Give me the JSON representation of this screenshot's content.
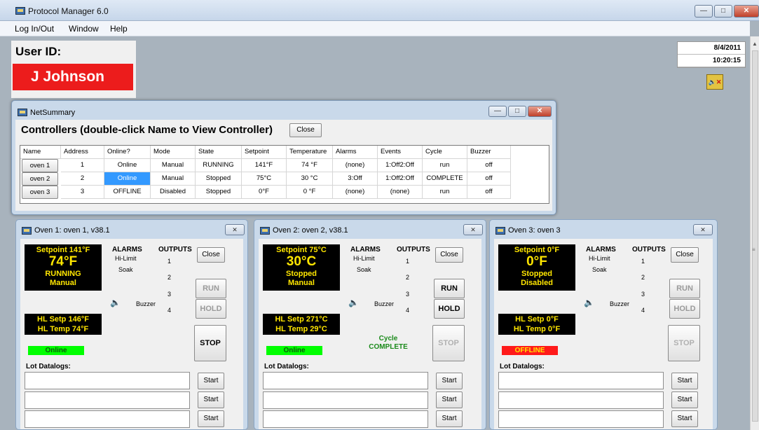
{
  "app": {
    "title": "Protocol Manager 6.0",
    "menu": [
      "Log In/Out",
      "Window",
      "Help"
    ]
  },
  "user": {
    "label": "User ID:",
    "name": "J Johnson"
  },
  "datetime": {
    "date": "8/4/2011",
    "time": "10:20:15"
  },
  "mute_icon": "speaker-muted-icon",
  "net": {
    "title": "NetSummary",
    "heading": "Controllers (double-click Name to View Controller)",
    "close_label": "Close",
    "columns": [
      "Name",
      "Address",
      "Online?",
      "Mode",
      "State",
      "Setpoint",
      "Temperature",
      "Alarms",
      "Events",
      "Cycle",
      "Buzzer"
    ],
    "rows": [
      [
        "oven 1",
        "1",
        "Online",
        "Manual",
        "RUNNING",
        "141°F",
        "74 °F",
        "(none)",
        "1:Off2:Off",
        "run",
        "off"
      ],
      [
        "oven 2",
        "2",
        "Online",
        "Manual",
        "Stopped",
        "75°C",
        "30 °C",
        "3:Off",
        "1:Off2:Off",
        "COMPLETE",
        "off"
      ],
      [
        "oven 3",
        "3",
        "OFFLINE",
        "Disabled",
        "Stopped",
        "0°F",
        "0 °F",
        "(none)",
        "(none)",
        "run",
        "off"
      ]
    ]
  },
  "colors": {
    "online": "#00ff00",
    "offline": "#ff1a1a",
    "display_text": "#ffe600",
    "user_bg": "#ec1c1c"
  },
  "ovens": [
    {
      "title": "Oven 1: oven 1, v38.1",
      "setpoint": "Setpoint 141°F",
      "temp": "74°F",
      "state": "RUNNING",
      "mode": "Manual",
      "alarms_label": "ALARMS",
      "alarm1": "Hi-Limit",
      "alarm2": "Soak",
      "outputs_label": "OUTPUTS",
      "out": [
        "1",
        "2",
        "3",
        "4"
      ],
      "buzzer": "Buzzer",
      "close": "Close",
      "run": "RUN",
      "hold": "HOLD",
      "stop": "STOP",
      "hl_setp": "HL Setp 146°F",
      "hl_temp": "HL Temp 74°F",
      "status": "Online",
      "cycle1": "",
      "cycle2": "",
      "lot_label": "Lot Datalogs:",
      "start": "Start"
    },
    {
      "title": "Oven 2: oven 2, v38.1",
      "setpoint": "Setpoint 75°C",
      "temp": "30°C",
      "state": "Stopped",
      "mode": "Manual",
      "alarms_label": "ALARMS",
      "alarm1": "Hi-Limit",
      "alarm2": "Soak",
      "outputs_label": "OUTPUTS",
      "out": [
        "1",
        "2",
        "3",
        "4"
      ],
      "buzzer": "Buzzer",
      "close": "Close",
      "run": "RUN",
      "hold": "HOLD",
      "stop": "STOP",
      "hl_setp": "HL Setp 271°C",
      "hl_temp": "HL Temp 29°C",
      "status": "Online",
      "cycle1": "Cycle",
      "cycle2": "COMPLETE",
      "lot_label": "Lot Datalogs:",
      "start": "Start"
    },
    {
      "title": "Oven 3: oven 3",
      "setpoint": "Setpoint 0°F",
      "temp": "0°F",
      "state": "Stopped",
      "mode": "Disabled",
      "alarms_label": "ALARMS",
      "alarm1": "Hi-Limit",
      "alarm2": "Soak",
      "outputs_label": "OUTPUTS",
      "out": [
        "1",
        "2",
        "3",
        "4"
      ],
      "buzzer": "Buzzer",
      "close": "Close",
      "run": "RUN",
      "hold": "HOLD",
      "stop": "STOP",
      "hl_setp": "HL Setp 0°F",
      "hl_temp": "HL Temp 0°F",
      "status": "OFFLINE",
      "cycle1": "",
      "cycle2": "",
      "lot_label": "Lot Datalogs:",
      "start": "Start"
    }
  ]
}
